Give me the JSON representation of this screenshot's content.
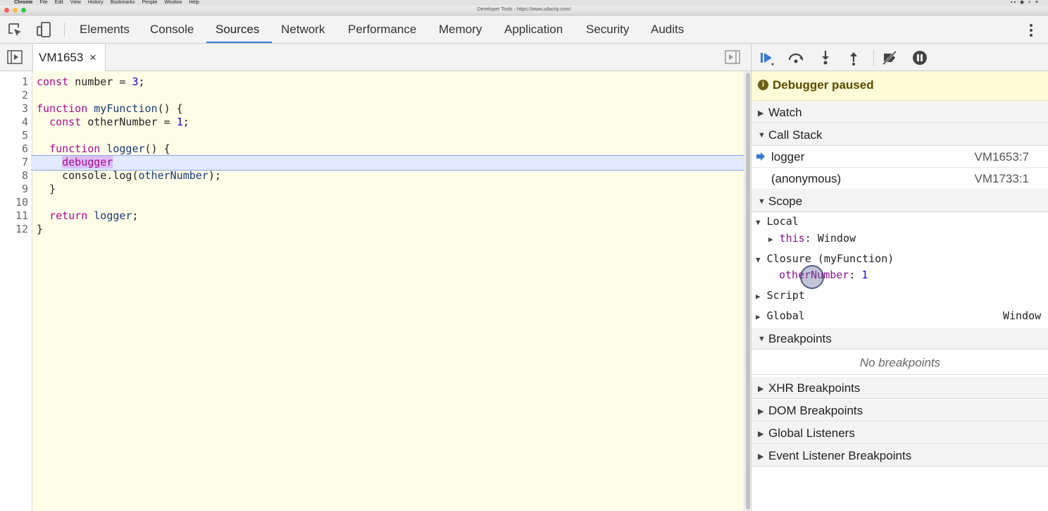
{
  "menubar": {
    "app": "Chrome",
    "items": [
      "File",
      "Edit",
      "View",
      "History",
      "Bookmarks",
      "People",
      "Window",
      "Help"
    ]
  },
  "window": {
    "title": "Developer Tools - https://www.udacity.com/"
  },
  "tabs": [
    {
      "label": "Elements",
      "active": false
    },
    {
      "label": "Console",
      "active": false
    },
    {
      "label": "Sources",
      "active": true
    },
    {
      "label": "Network",
      "active": false
    },
    {
      "label": "Performance",
      "active": false
    },
    {
      "label": "Memory",
      "active": false
    },
    {
      "label": "Application",
      "active": false
    },
    {
      "label": "Security",
      "active": false
    },
    {
      "label": "Audits",
      "active": false
    }
  ],
  "editor": {
    "file_tab": "VM1653",
    "close_glyph": "×",
    "lines": [
      {
        "n": "1",
        "text": "const number = 3;"
      },
      {
        "n": "2",
        "text": ""
      },
      {
        "n": "3",
        "text": "function myFunction() {"
      },
      {
        "n": "4",
        "text": "  const otherNumber = 1;"
      },
      {
        "n": "5",
        "text": ""
      },
      {
        "n": "6",
        "text": "  function logger() {"
      },
      {
        "n": "7",
        "text": "    debugger"
      },
      {
        "n": "8",
        "text": "    console.log(otherNumber);"
      },
      {
        "n": "9",
        "text": "  }"
      },
      {
        "n": "10",
        "text": ""
      },
      {
        "n": "11",
        "text": "  return logger;"
      },
      {
        "n": "12",
        "text": "}"
      }
    ],
    "paused_line": 7
  },
  "debugger": {
    "status": "Debugger paused",
    "watch": "Watch",
    "call_stack_title": "Call Stack",
    "call_stack": [
      {
        "name": "logger",
        "loc": "VM1653:7",
        "current": true
      },
      {
        "name": "(anonymous)",
        "loc": "VM1733:1",
        "current": false
      }
    ],
    "scope_title": "Scope",
    "scope": {
      "local": "Local",
      "this_key": "this",
      "this_val": "Window",
      "closure": "Closure (myFunction)",
      "other_key": "otherNumber",
      "other_val": "1",
      "script": "Script",
      "global": "Global",
      "global_val": "Window"
    },
    "breakpoints_title": "Breakpoints",
    "no_breakpoints": "No breakpoints",
    "xhr": "XHR Breakpoints",
    "dom": "DOM Breakpoints",
    "global_listeners": "Global Listeners",
    "event_listener": "Event Listener Breakpoints"
  }
}
